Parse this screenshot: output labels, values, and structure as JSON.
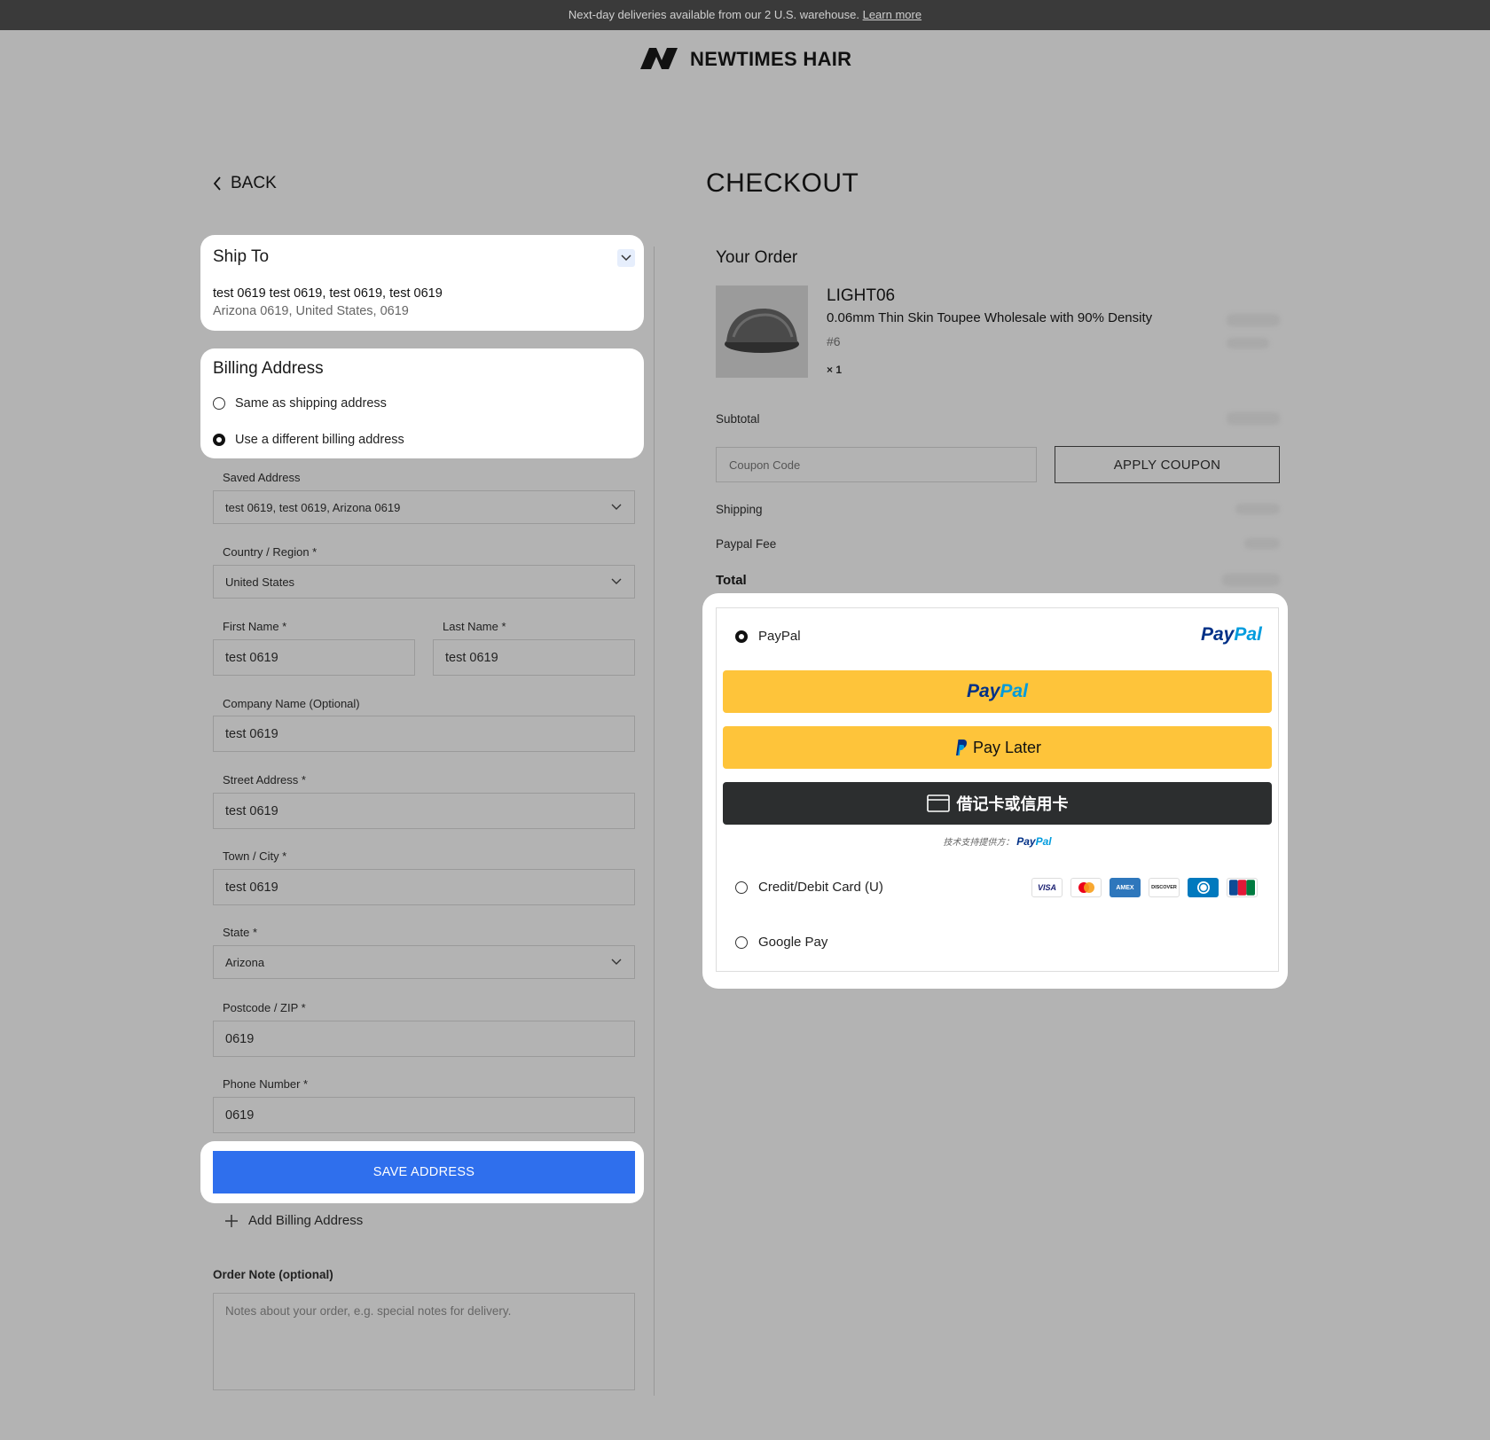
{
  "announcement": {
    "text": "Next-day deliveries available from our 2 U.S. warehouse.",
    "link": "Learn more"
  },
  "brand": {
    "name": "NEWTIMES HAIR"
  },
  "nav": {
    "back": "BACK"
  },
  "page": {
    "title": "CHECKOUT"
  },
  "ship_to": {
    "title": "Ship To",
    "line1": "test 0619 test 0619, test 0619, test 0619",
    "line2": "Arizona 0619, United States, 0619"
  },
  "billing": {
    "title": "Billing Address",
    "option_same": "Same as shipping address",
    "option_different": "Use a different billing address",
    "selected": "different"
  },
  "form": {
    "saved_address": {
      "label": "Saved Address",
      "value": "test 0619, test 0619, Arizona 0619"
    },
    "country": {
      "label": "Country / Region *",
      "value": "United States"
    },
    "first_name": {
      "label": "First Name *",
      "value": "test 0619"
    },
    "last_name": {
      "label": "Last Name *",
      "value": "test 0619"
    },
    "company": {
      "label": "Company Name (Optional)",
      "value": "test 0619"
    },
    "street": {
      "label": "Street Address *",
      "value": "test 0619"
    },
    "city": {
      "label": "Town / City *",
      "value": "test 0619"
    },
    "state": {
      "label": "State *",
      "value": "Arizona"
    },
    "postcode": {
      "label": "Postcode / ZIP *",
      "value": "0619"
    },
    "phone": {
      "label": "Phone Number *",
      "value": "0619"
    },
    "save_button": "SAVE ADDRESS",
    "add_billing": "Add Billing Address",
    "order_note_label": "Order Note (optional)",
    "order_note_placeholder": "Notes about your order, e.g. special notes for delivery."
  },
  "order": {
    "title": "Your Order",
    "item": {
      "code": "LIGHT06",
      "name": "0.06mm Thin Skin Toupee Wholesale with 90% Density",
      "variant": "#6",
      "qty": "× 1"
    },
    "subtotal_label": "Subtotal",
    "coupon_placeholder": "Coupon Code",
    "apply_coupon": "APPLY COUPON",
    "shipping_label": "Shipping",
    "paypal_fee_label": "Paypal Fee",
    "total_label": "Total"
  },
  "payment": {
    "paypal_option": "PayPal",
    "paypal_brand_pay": "Pay",
    "paypal_brand_pal": "Pal",
    "pay_later": "Pay Later",
    "card_button": "借记卡或信用卡",
    "powered_by": "技术支持提供方：",
    "credit_option": "Credit/Debit Card (U)",
    "google_option": "Google Pay",
    "card_brands": [
      "VISA",
      "MC",
      "AMEX",
      "DISCOVER",
      "DINERS",
      "JCB"
    ],
    "colors": {
      "paypal_yellow": "#fec43a",
      "paypal_dark_blue": "#003087",
      "paypal_light_blue": "#009cde",
      "save_blue": "#2f6fed"
    }
  }
}
